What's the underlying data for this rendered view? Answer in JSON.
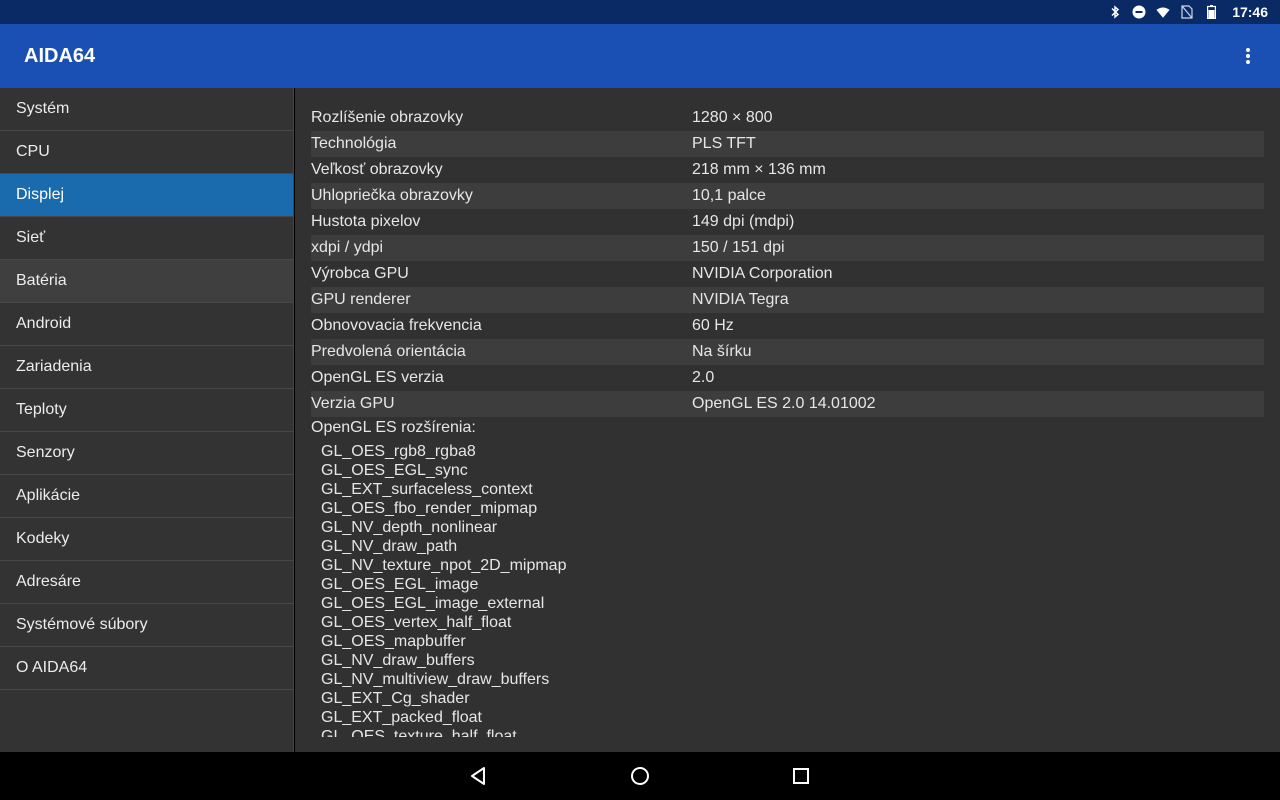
{
  "status_bar": {
    "time": "17:46",
    "icons": [
      "bluetooth-icon",
      "do-not-disturb-icon",
      "wifi-icon",
      "no-sim-icon",
      "battery-icon"
    ]
  },
  "app_bar": {
    "title": "AIDA64",
    "overflow_icon": "more-vert-icon"
  },
  "sidebar": {
    "items": [
      {
        "label": "Systém"
      },
      {
        "label": "CPU"
      },
      {
        "label": "Displej",
        "selected": true
      },
      {
        "label": "Sieť"
      },
      {
        "label": "Batéria"
      },
      {
        "label": "Android"
      },
      {
        "label": "Zariadenia"
      },
      {
        "label": "Teploty"
      },
      {
        "label": "Senzory"
      },
      {
        "label": "Aplikácie"
      },
      {
        "label": "Kodeky"
      },
      {
        "label": "Adresáre"
      },
      {
        "label": "Systémové súbory"
      },
      {
        "label": "O AIDA64"
      }
    ]
  },
  "display_info": {
    "rows": [
      {
        "label": "Rozlíšenie obrazovky",
        "value": "1280 × 800"
      },
      {
        "label": "Technológia",
        "value": "PLS TFT"
      },
      {
        "label": "Veľkosť obrazovky",
        "value": "218 mm × 136 mm"
      },
      {
        "label": "Uhlopriečka obrazovky",
        "value": "10,1 palce"
      },
      {
        "label": "Hustota pixelov",
        "value": "149 dpi (mdpi)"
      },
      {
        "label": "xdpi / ydpi",
        "value": "150 / 151 dpi"
      },
      {
        "label": "Výrobca GPU",
        "value": "NVIDIA Corporation"
      },
      {
        "label": "GPU renderer",
        "value": "NVIDIA Tegra"
      },
      {
        "label": "Obnovovacia frekvencia",
        "value": "60 Hz"
      },
      {
        "label": "Predvolená orientácia",
        "value": "Na šírku"
      },
      {
        "label": "OpenGL ES verzia",
        "value": "2.0"
      },
      {
        "label": "Verzia GPU",
        "value": "OpenGL ES 2.0 14.01002"
      }
    ],
    "extensions_title": "OpenGL ES rozšírenia:",
    "extensions": [
      "GL_OES_rgb8_rgba8",
      "GL_OES_EGL_sync",
      "GL_EXT_surfaceless_context",
      "GL_OES_fbo_render_mipmap",
      "GL_NV_depth_nonlinear",
      "GL_NV_draw_path",
      "GL_NV_texture_npot_2D_mipmap",
      "GL_OES_EGL_image",
      "GL_OES_EGL_image_external",
      "GL_OES_vertex_half_float",
      "GL_OES_mapbuffer",
      "GL_NV_draw_buffers",
      "GL_NV_multiview_draw_buffers",
      "GL_EXT_Cg_shader",
      "GL_EXT_packed_float",
      "GL_OES_texture_half_float"
    ]
  },
  "nav_bar": {
    "buttons": [
      "back-icon",
      "home-icon",
      "recents-icon"
    ]
  },
  "colors": {
    "status_bar": "#0a2a66",
    "app_bar": "#1a4fb4",
    "selected": "#1a6aae",
    "sidebar_bg": "#333333",
    "content_bg": "#313131"
  }
}
